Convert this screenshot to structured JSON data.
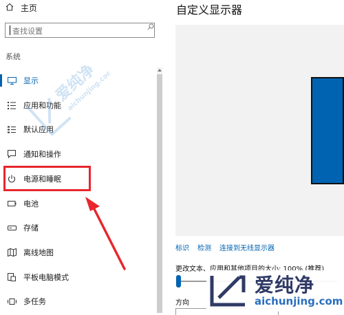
{
  "sidebar": {
    "home_label": "主页",
    "search_placeholder": "查找设置",
    "section_title": "系统",
    "items": [
      {
        "label": "显示",
        "icon": "monitor-icon"
      },
      {
        "label": "应用和功能",
        "icon": "apps-list-icon"
      },
      {
        "label": "默认应用",
        "icon": "default-apps-icon"
      },
      {
        "label": "通知和操作",
        "icon": "notification-icon"
      },
      {
        "label": "电源和睡眠",
        "icon": "power-icon"
      },
      {
        "label": "电池",
        "icon": "battery-icon"
      },
      {
        "label": "存储",
        "icon": "storage-icon"
      },
      {
        "label": "离线地图",
        "icon": "map-icon"
      },
      {
        "label": "平板电脑模式",
        "icon": "tablet-icon"
      },
      {
        "label": "多任务",
        "icon": "multitask-icon"
      }
    ],
    "active_index": 0,
    "highlighted_index": 4
  },
  "main": {
    "title": "自定义显示器",
    "links": [
      "标识",
      "检测",
      "连接到无线显示器"
    ],
    "scale_label": "更改文本、应用和其他项目的大小: 100% (推荐)",
    "scale_value_percent": 100,
    "orientation_label": "方向"
  },
  "watermark": {
    "brand_cn": "爱纯净",
    "brand_url": "aichunjing.com"
  },
  "colors": {
    "accent": "#0063b1",
    "highlight_box": "#e8262d",
    "arrow": "#e8262d",
    "preview_bg": "#f2f2f2",
    "watermark_text": "#2f3a66",
    "watermark_url": "#2a6fbe"
  }
}
